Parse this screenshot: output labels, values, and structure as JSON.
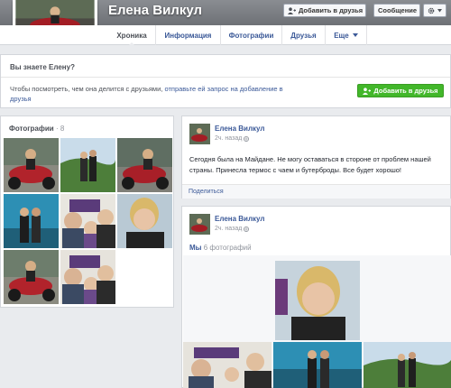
{
  "header": {
    "name": "Елена Вилкул",
    "add_friend_label": "Добавить в друзья",
    "message_label": "Сообщение",
    "more_icon": "gear-icon"
  },
  "tabs": [
    {
      "label": "Хроника"
    },
    {
      "label": "Информация"
    },
    {
      "label": "Фотографии"
    },
    {
      "label": "Друзья"
    },
    {
      "label": "Еще"
    }
  ],
  "know_box": {
    "title": "Вы знаете Елену?",
    "text_before": "Чтобы посмотреть, чем она делится с друзьями, ",
    "link_text": "отправьте ей запрос на добавление в друзья",
    "button_label": "Добавить в друзья"
  },
  "photos": {
    "title": "Фотографии",
    "separator": " · ",
    "count": "8"
  },
  "post1": {
    "author": "Елена Вилкул",
    "time": "2ч. назад",
    "text": "Сегодня была на Майдане. Не могу оставаться в стороне от проблем нашей страны. Принесла термос с чаем и бутерброды. Все будет хорошо!",
    "share_label": "Поделиться"
  },
  "post2": {
    "author": "Елена Вилкул",
    "time": "2ч. назад",
    "album_name": "Мы",
    "album_count": "6 фотографий"
  },
  "colors": {
    "link": "#3b5998",
    "green_button": "#42b72a",
    "page_bg": "#e9ebee"
  }
}
